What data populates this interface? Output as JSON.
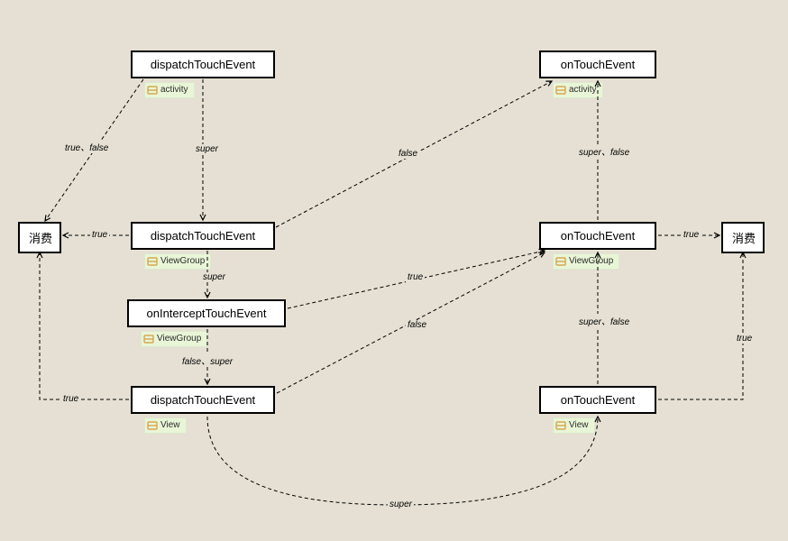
{
  "nodes": {
    "n1": {
      "label": "dispatchTouchEvent",
      "tag": "activity"
    },
    "n2": {
      "label": "onTouchEvent",
      "tag": "activity"
    },
    "n3": {
      "label": "dispatchTouchEvent",
      "tag": "ViewGroup"
    },
    "n4": {
      "label": "onTouchEvent",
      "tag": "ViewGroup"
    },
    "n5": {
      "label": "onInterceptTouchEvent",
      "tag": "ViewGroup"
    },
    "n6": {
      "label": "dispatchTouchEvent",
      "tag": "View"
    },
    "n7": {
      "label": "onTouchEvent",
      "tag": "View"
    },
    "consume_left": {
      "label": "消费"
    },
    "consume_right": {
      "label": "消费"
    }
  },
  "edge_labels": {
    "e1": "true、false",
    "e2": "super",
    "e3": "false",
    "e4": "super、false",
    "e5": "true",
    "e6": "super",
    "e7": "true",
    "e8": "true",
    "e9": "false、super",
    "e10": "true",
    "e11": "false",
    "e12": "super、false",
    "e13": "true",
    "e14": "super"
  }
}
